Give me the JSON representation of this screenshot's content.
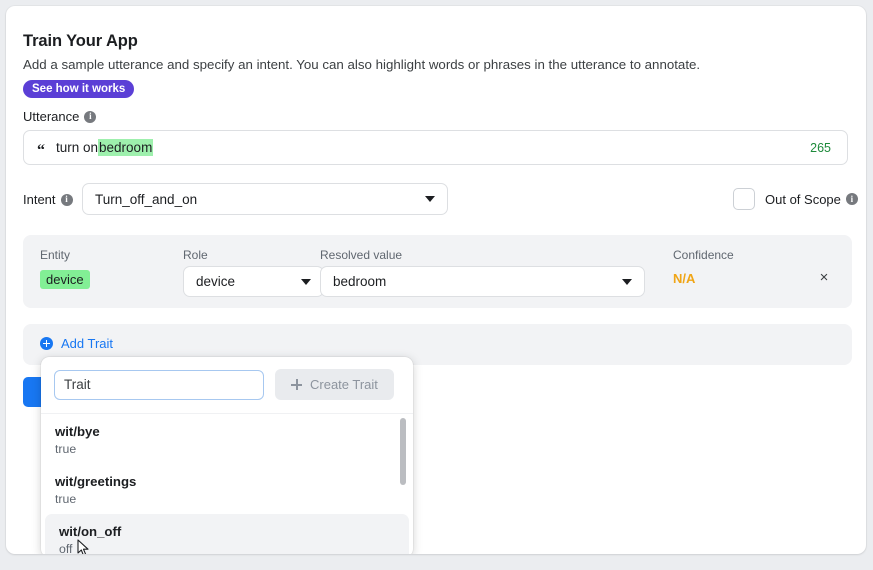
{
  "header": {
    "title": "Train Your App",
    "subtitle": "Add a sample utterance and specify an intent. You can also highlight words or phrases in the utterance to annotate.",
    "badge_label": "See how it works"
  },
  "utterance": {
    "label": "Utterance",
    "info_icon": "info-icon",
    "quote_glyph": "“",
    "text_plain": "turn on ",
    "text_highlighted": "bedroom",
    "highlight_color": "#9ef0ad",
    "counter": "265",
    "counter_color": "#1d8a3a"
  },
  "intent": {
    "label": "Intent",
    "value": "Turn_off_and_on",
    "out_of_scope_label": "Out of Scope",
    "out_of_scope_checked": false
  },
  "entity_panel": {
    "columns": {
      "entity": "Entity",
      "role": "Role",
      "resolved_value": "Resolved value",
      "confidence": "Confidence"
    },
    "row": {
      "entity": "device",
      "entity_color": "#82ef95",
      "role": "device",
      "resolved_value": "bedroom",
      "confidence": "N/A",
      "confidence_color": "#f0a516",
      "remove_glyph": "×"
    }
  },
  "add_trait": {
    "label": "Add Trait",
    "link_color": "#1877f2"
  },
  "trait_popover": {
    "input_placeholder": "Trait",
    "input_value": "",
    "create_button_label": "Create Trait",
    "items": [
      {
        "name": "wit/bye",
        "value": "true",
        "hovered": false
      },
      {
        "name": "wit/greetings",
        "value": "true",
        "hovered": false
      },
      {
        "name": "wit/on_off",
        "value": "off",
        "hovered": true
      }
    ]
  },
  "train_button": {
    "color": "#1877f2"
  }
}
